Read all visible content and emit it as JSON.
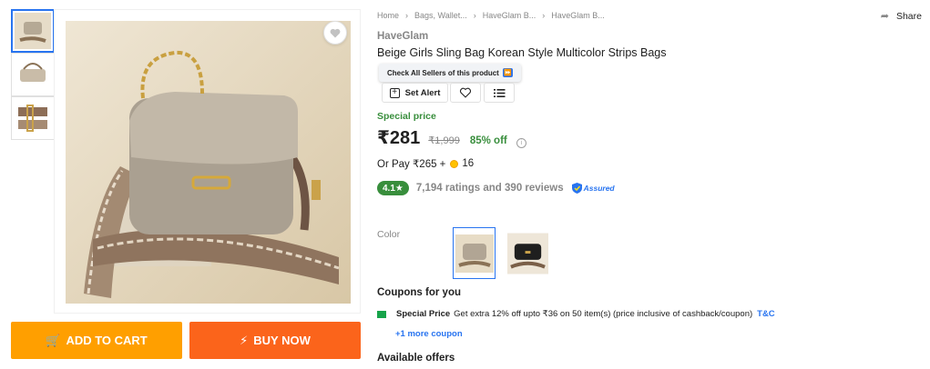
{
  "gallery": {
    "thumbnails": [
      "bag-front-view",
      "bag-side-view",
      "bag-strap-detail"
    ],
    "wishlist_icon": "heart-icon"
  },
  "actions": {
    "add_to_cart": "ADD TO CART",
    "buy_now": "BUY NOW",
    "cart_icon": "cart-icon",
    "bolt_icon": "lightning-icon"
  },
  "breadcrumb": [
    "Home",
    "Bags, Wallet...",
    "HaveGlam B...",
    "HaveGlam B..."
  ],
  "share_label": "Share",
  "product": {
    "brand": "HaveGlam",
    "title": "Beige Girls Sling Bag Korean Style Multicolor Strips Bags",
    "seller_tip": "Check All Sellers of this product",
    "set_alert": "Set Alert",
    "special_label": "Special price",
    "price": "₹281",
    "mrp": "₹1,999",
    "discount": "85% off",
    "or_pay_prefix": "Or Pay ₹265 +",
    "coins": "16",
    "rating": "4.1★",
    "rating_count": "7,194 ratings and 390 reviews",
    "assured": "Assured"
  },
  "color": {
    "label": "Color",
    "options": [
      "beige",
      "black"
    ],
    "selected": "beige"
  },
  "coupons": {
    "title": "Coupons for you",
    "label": "Special Price",
    "text": "Get extra 12% off upto ₹36 on 50 item(s) (price inclusive of cashback/coupon)",
    "tc": "T&C",
    "more": "+1 more coupon"
  },
  "offers_title": "Available offers",
  "colors": {
    "primary": "#2874f0",
    "cart": "#ff9f00",
    "buy": "#fb641b",
    "green": "#388e3c"
  }
}
